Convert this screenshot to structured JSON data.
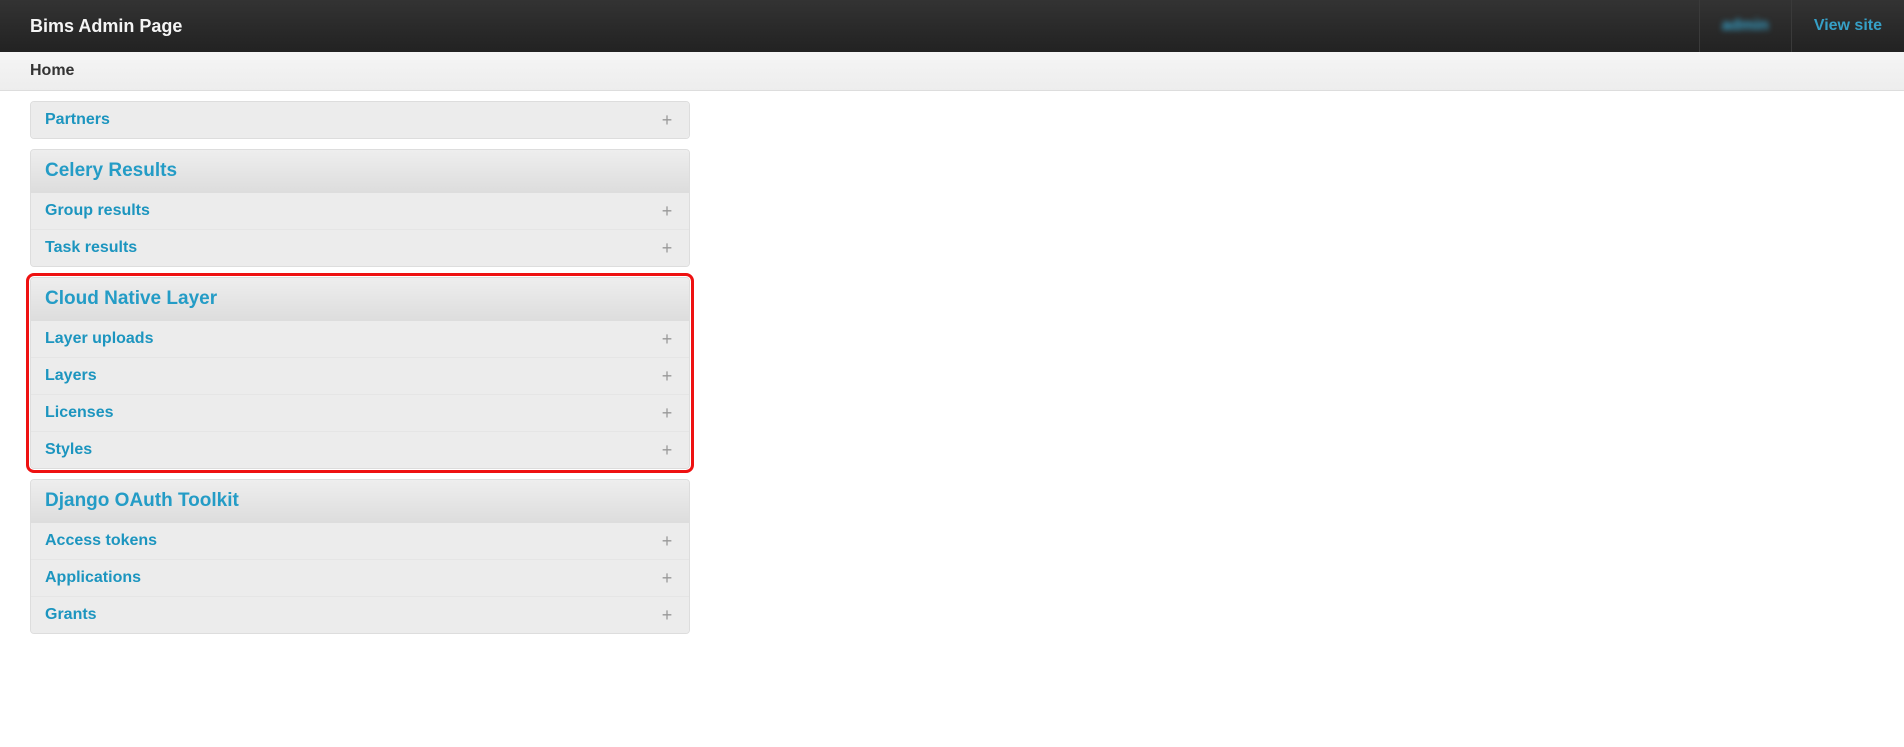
{
  "navbar": {
    "brand": "Bims Admin Page",
    "user": "admin",
    "view_site": "View site"
  },
  "breadcrumbs": {
    "current": "Home"
  },
  "modules": {
    "partners_row_label": "Partners",
    "celery": {
      "caption": "Celery Results",
      "rows": [
        {
          "label": "Group results"
        },
        {
          "label": "Task results"
        }
      ]
    },
    "cloud_native": {
      "caption": "Cloud Native Layer",
      "rows": [
        {
          "label": "Layer uploads"
        },
        {
          "label": "Layers"
        },
        {
          "label": "Licenses"
        },
        {
          "label": "Styles"
        }
      ]
    },
    "oauth": {
      "caption": "Django OAuth Toolkit",
      "rows": [
        {
          "label": "Access tokens"
        },
        {
          "label": "Applications"
        },
        {
          "label": "Grants"
        }
      ]
    }
  },
  "icons": {
    "add": "+"
  }
}
